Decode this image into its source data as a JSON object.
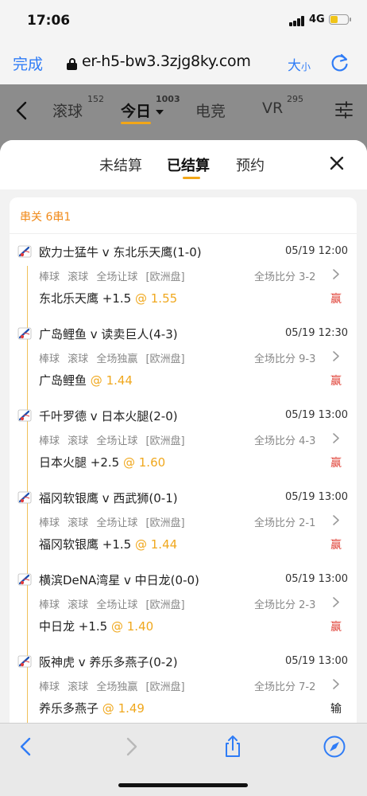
{
  "status_bar": {
    "time": "17:06",
    "network": "4G",
    "battery_level": 0.45,
    "battery_color": "#f0c419"
  },
  "browser": {
    "done_label": "完成",
    "url": "er-h5-bw3.3zjg8ky.com",
    "text_size_big": "大",
    "text_size_small": "小",
    "accent_color": "#2f7cf6"
  },
  "app_header": {
    "tabs": [
      {
        "label": "滚球",
        "count": "152"
      },
      {
        "label": "今日",
        "count": "1003"
      },
      {
        "label": "电竞",
        "count": ""
      },
      {
        "label": "VR",
        "count": "295"
      }
    ]
  },
  "sheet": {
    "tabs": [
      "未结算",
      "已结算",
      "预约"
    ],
    "active_tab": "已结算",
    "card": {
      "title": "串关 6串1",
      "legs": [
        {
          "match": "欧力士猛牛 v 东北乐天鹰(1-0)",
          "time": "05/19 12:00",
          "sport": "棒球",
          "mode": "滚球",
          "market": "全场让球",
          "odds_type": "[欧洲盘]",
          "score": "全场比分 3-2",
          "pick": "东北乐天鹰 +1.5",
          "odds": "@ 1.55",
          "result": "赢"
        },
        {
          "match": "广岛鲤鱼 v 读卖巨人(4-3)",
          "time": "05/19 12:30",
          "sport": "棒球",
          "mode": "滚球",
          "market": "全场独赢",
          "odds_type": "[欧洲盘]",
          "score": "全场比分 9-3",
          "pick": "广岛鲤鱼",
          "odds": "@ 1.44",
          "result": "赢"
        },
        {
          "match": "千叶罗德 v 日本火腿(2-0)",
          "time": "05/19 13:00",
          "sport": "棒球",
          "mode": "滚球",
          "market": "全场让球",
          "odds_type": "[欧洲盘]",
          "score": "全场比分 4-3",
          "pick": "日本火腿 +2.5",
          "odds": "@ 1.60",
          "result": "赢"
        },
        {
          "match": "福冈软银鹰 v 西武狮(0-1)",
          "time": "05/19 13:00",
          "sport": "棒球",
          "mode": "滚球",
          "market": "全场让球",
          "odds_type": "[欧洲盘]",
          "score": "全场比分 2-1",
          "pick": "福冈软银鹰 +1.5",
          "odds": "@ 1.44",
          "result": "赢"
        },
        {
          "match": "横滨DeNA湾星 v 中日龙(0-0)",
          "time": "05/19 13:00",
          "sport": "棒球",
          "mode": "滚球",
          "market": "全场让球",
          "odds_type": "[欧洲盘]",
          "score": "全场比分 2-3",
          "pick": "中日龙 +1.5",
          "odds": "@ 1.40",
          "result": "赢"
        },
        {
          "match": "阪神虎 v 养乐多燕子(0-2)",
          "time": "05/19 13:00",
          "sport": "棒球",
          "mode": "滚球",
          "market": "全场独赢",
          "odds_type": "[欧洲盘]",
          "score": "全场比分 7-2",
          "pick": "养乐多燕子",
          "odds": "@ 1.49",
          "result": "输"
        }
      ]
    }
  },
  "colors": {
    "win": "#e0443a",
    "lose": "#222222",
    "odds": "#f0a81e",
    "parlay": "#f08a1a"
  }
}
